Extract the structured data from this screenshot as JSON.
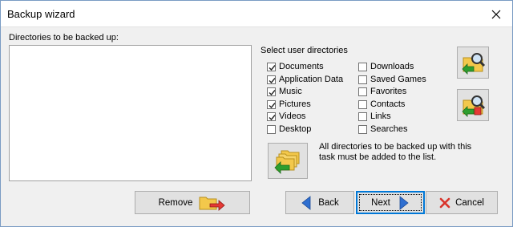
{
  "window": {
    "title": "Backup wizard"
  },
  "left_panel": {
    "list_label": "Directories to be backed up:"
  },
  "user_dirs": {
    "header": "Select user directories",
    "items": [
      {
        "label": "Documents",
        "checked": true
      },
      {
        "label": "Application Data",
        "checked": true
      },
      {
        "label": "Music",
        "checked": true
      },
      {
        "label": "Pictures",
        "checked": true
      },
      {
        "label": "Videos",
        "checked": true
      },
      {
        "label": "Desktop",
        "checked": false
      },
      {
        "label": "Downloads",
        "checked": false
      },
      {
        "label": "Saved Games",
        "checked": false
      },
      {
        "label": "Favorites",
        "checked": false
      },
      {
        "label": "Contacts",
        "checked": false
      },
      {
        "label": "Links",
        "checked": false
      },
      {
        "label": "Searches",
        "checked": false
      }
    ]
  },
  "message": "All directories to be backed up with this task must be added to the list.",
  "buttons": {
    "remove": "Remove",
    "back": "Back",
    "next": "Next",
    "cancel": "Cancel"
  },
  "icons": {
    "browse_folder": "folder-search-icon",
    "browse_network": "folder-search-network-icon",
    "add_selected": "add-folders-icon",
    "remove": "remove-folder-icon",
    "back": "arrow-left-icon",
    "next": "arrow-right-icon",
    "cancel": "red-x-icon"
  },
  "colors": {
    "arrow_blue": "#2f6fd0",
    "arrow_green": "#2e9e2e",
    "folder_yellow": "#f3c84b",
    "cancel_red": "#d9342b",
    "remove_red": "#e53935"
  }
}
